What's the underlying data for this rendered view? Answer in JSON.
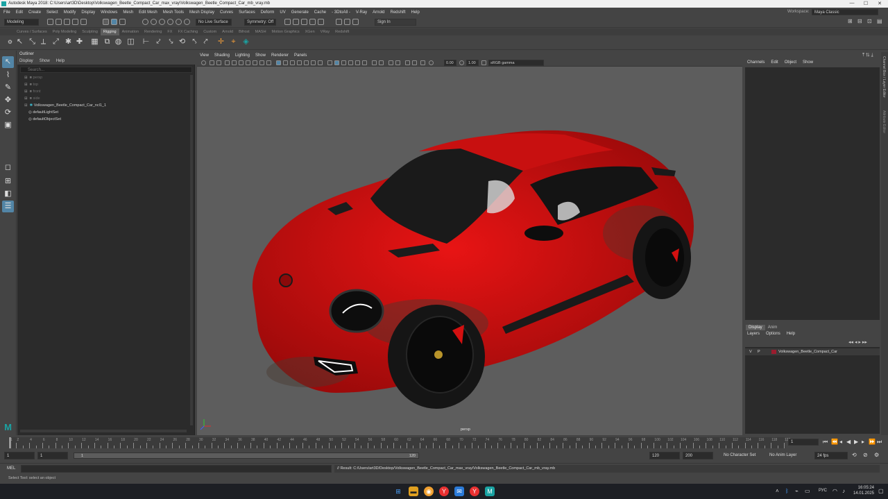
{
  "window": {
    "title": "Autodesk Maya 2018: C:\\Users\\art3D\\Desktop\\Volkswagen_Beetle_Compact_Car_max_vray\\Volkswagen_Beetle_Compact_Car_mb_vray.mb",
    "minimize": "—",
    "maximize": "☐",
    "close": "✕"
  },
  "menubar": {
    "items": [
      "File",
      "Edit",
      "Create",
      "Select",
      "Modify",
      "Display",
      "Windows",
      "Mesh",
      "Edit Mesh",
      "Mesh Tools",
      "Mesh Display",
      "Curves",
      "Surfaces",
      "Deform",
      "UV",
      "Generate",
      "Cache",
      "- 3DtoAll -",
      "V-Ray",
      "Arnold",
      "Redshift",
      "Help"
    ],
    "workspace_label": "Workspace:",
    "workspace_value": "Maya Classic"
  },
  "statusline": {
    "mode": "Modeling",
    "live_surface": "No Live Surface",
    "symmetry": "Symmetry: Off",
    "sign_in": "Sign In"
  },
  "shelf": {
    "tabs": [
      "Curves / Surfaces",
      "Poly Modeling",
      "Sculpting",
      "Rigging",
      "Animation",
      "Rendering",
      "FX",
      "FX Caching",
      "Custom",
      "Arnold",
      "Bifrost",
      "MASH",
      "Motion Graphics",
      "XGen",
      "VRay",
      "Redshift"
    ],
    "active_tab": "Rigging"
  },
  "outliner": {
    "title": "Outliner",
    "menu": [
      "Display",
      "Show",
      "Help"
    ],
    "search_placeholder": "Search...",
    "items": [
      {
        "label": "persp",
        "dim": true,
        "expand": "⊞"
      },
      {
        "label": "top",
        "dim": true,
        "expand": "⊞"
      },
      {
        "label": "front",
        "dim": true,
        "expand": "⊞"
      },
      {
        "label": "side",
        "dim": true,
        "expand": "⊞"
      },
      {
        "label": "Volkswagen_Beetle_Compact_Car_ncl1_1",
        "dim": false,
        "expand": "⊞"
      },
      {
        "label": "defaultLightSet",
        "dim": false,
        "expand": ""
      },
      {
        "label": "defaultObjectSet",
        "dim": false,
        "expand": ""
      }
    ]
  },
  "viewport": {
    "menu": [
      "View",
      "Shading",
      "Lighting",
      "Show",
      "Renderer",
      "Panels"
    ],
    "exposure": "0.00",
    "gamma": "1.00",
    "color_space": "sRGB gamma",
    "camera": "persp"
  },
  "channelbox": {
    "menu": [
      "Channels",
      "Edit",
      "Object",
      "Show"
    ]
  },
  "side_tabs": [
    "Channel Box / Layer Editor",
    "Attribute Editor"
  ],
  "layers": {
    "tabs": [
      "Display",
      "Anim"
    ],
    "menu": [
      "Layers",
      "Options",
      "Help"
    ],
    "rows": [
      {
        "v": "V",
        "p": "P",
        "name": "Volkswagen_Beetle_Compact_Car",
        "color": "#9a1c2e"
      }
    ]
  },
  "timeline": {
    "labels": [
      "1",
      "2",
      "4",
      "6",
      "8",
      "10",
      "12",
      "14",
      "16",
      "18",
      "20",
      "22",
      "24",
      "26",
      "28",
      "30",
      "32",
      "34",
      "36",
      "38",
      "40",
      "42",
      "44",
      "46",
      "48",
      "50",
      "52",
      "54",
      "56",
      "58",
      "60",
      "62",
      "64",
      "66",
      "68",
      "70",
      "72",
      "74",
      "76",
      "78",
      "80",
      "82",
      "84",
      "86",
      "88",
      "90",
      "92",
      "94",
      "96",
      "98",
      "100",
      "102",
      "104",
      "106",
      "108",
      "110",
      "112",
      "114",
      "116",
      "118",
      "120"
    ],
    "current_frame": "1"
  },
  "range": {
    "start": "1",
    "playback_start": "1",
    "bar_start": "1",
    "bar_end": "120",
    "playback_end": "120",
    "end": "200",
    "character_set": "No Character Set",
    "anim_layer": "No Anim Layer",
    "fps": "24 fps"
  },
  "cmdline": {
    "label": "MEL",
    "result": "// Result: C:/Users/art3D/Desktop/Volkswagen_Beetle_Compact_Car_max_vray/Volkswagen_Beetle_Compact_Car_mb_vray.mb"
  },
  "helpline": "Select Tool: select an object",
  "taskbar": {
    "lang": "РУС",
    "time": "16:05:24",
    "date": "14.01.2025"
  },
  "colors": {
    "car_body": "#d31010",
    "selection": "#5285a6",
    "maya_teal": "#1aa3a3"
  }
}
